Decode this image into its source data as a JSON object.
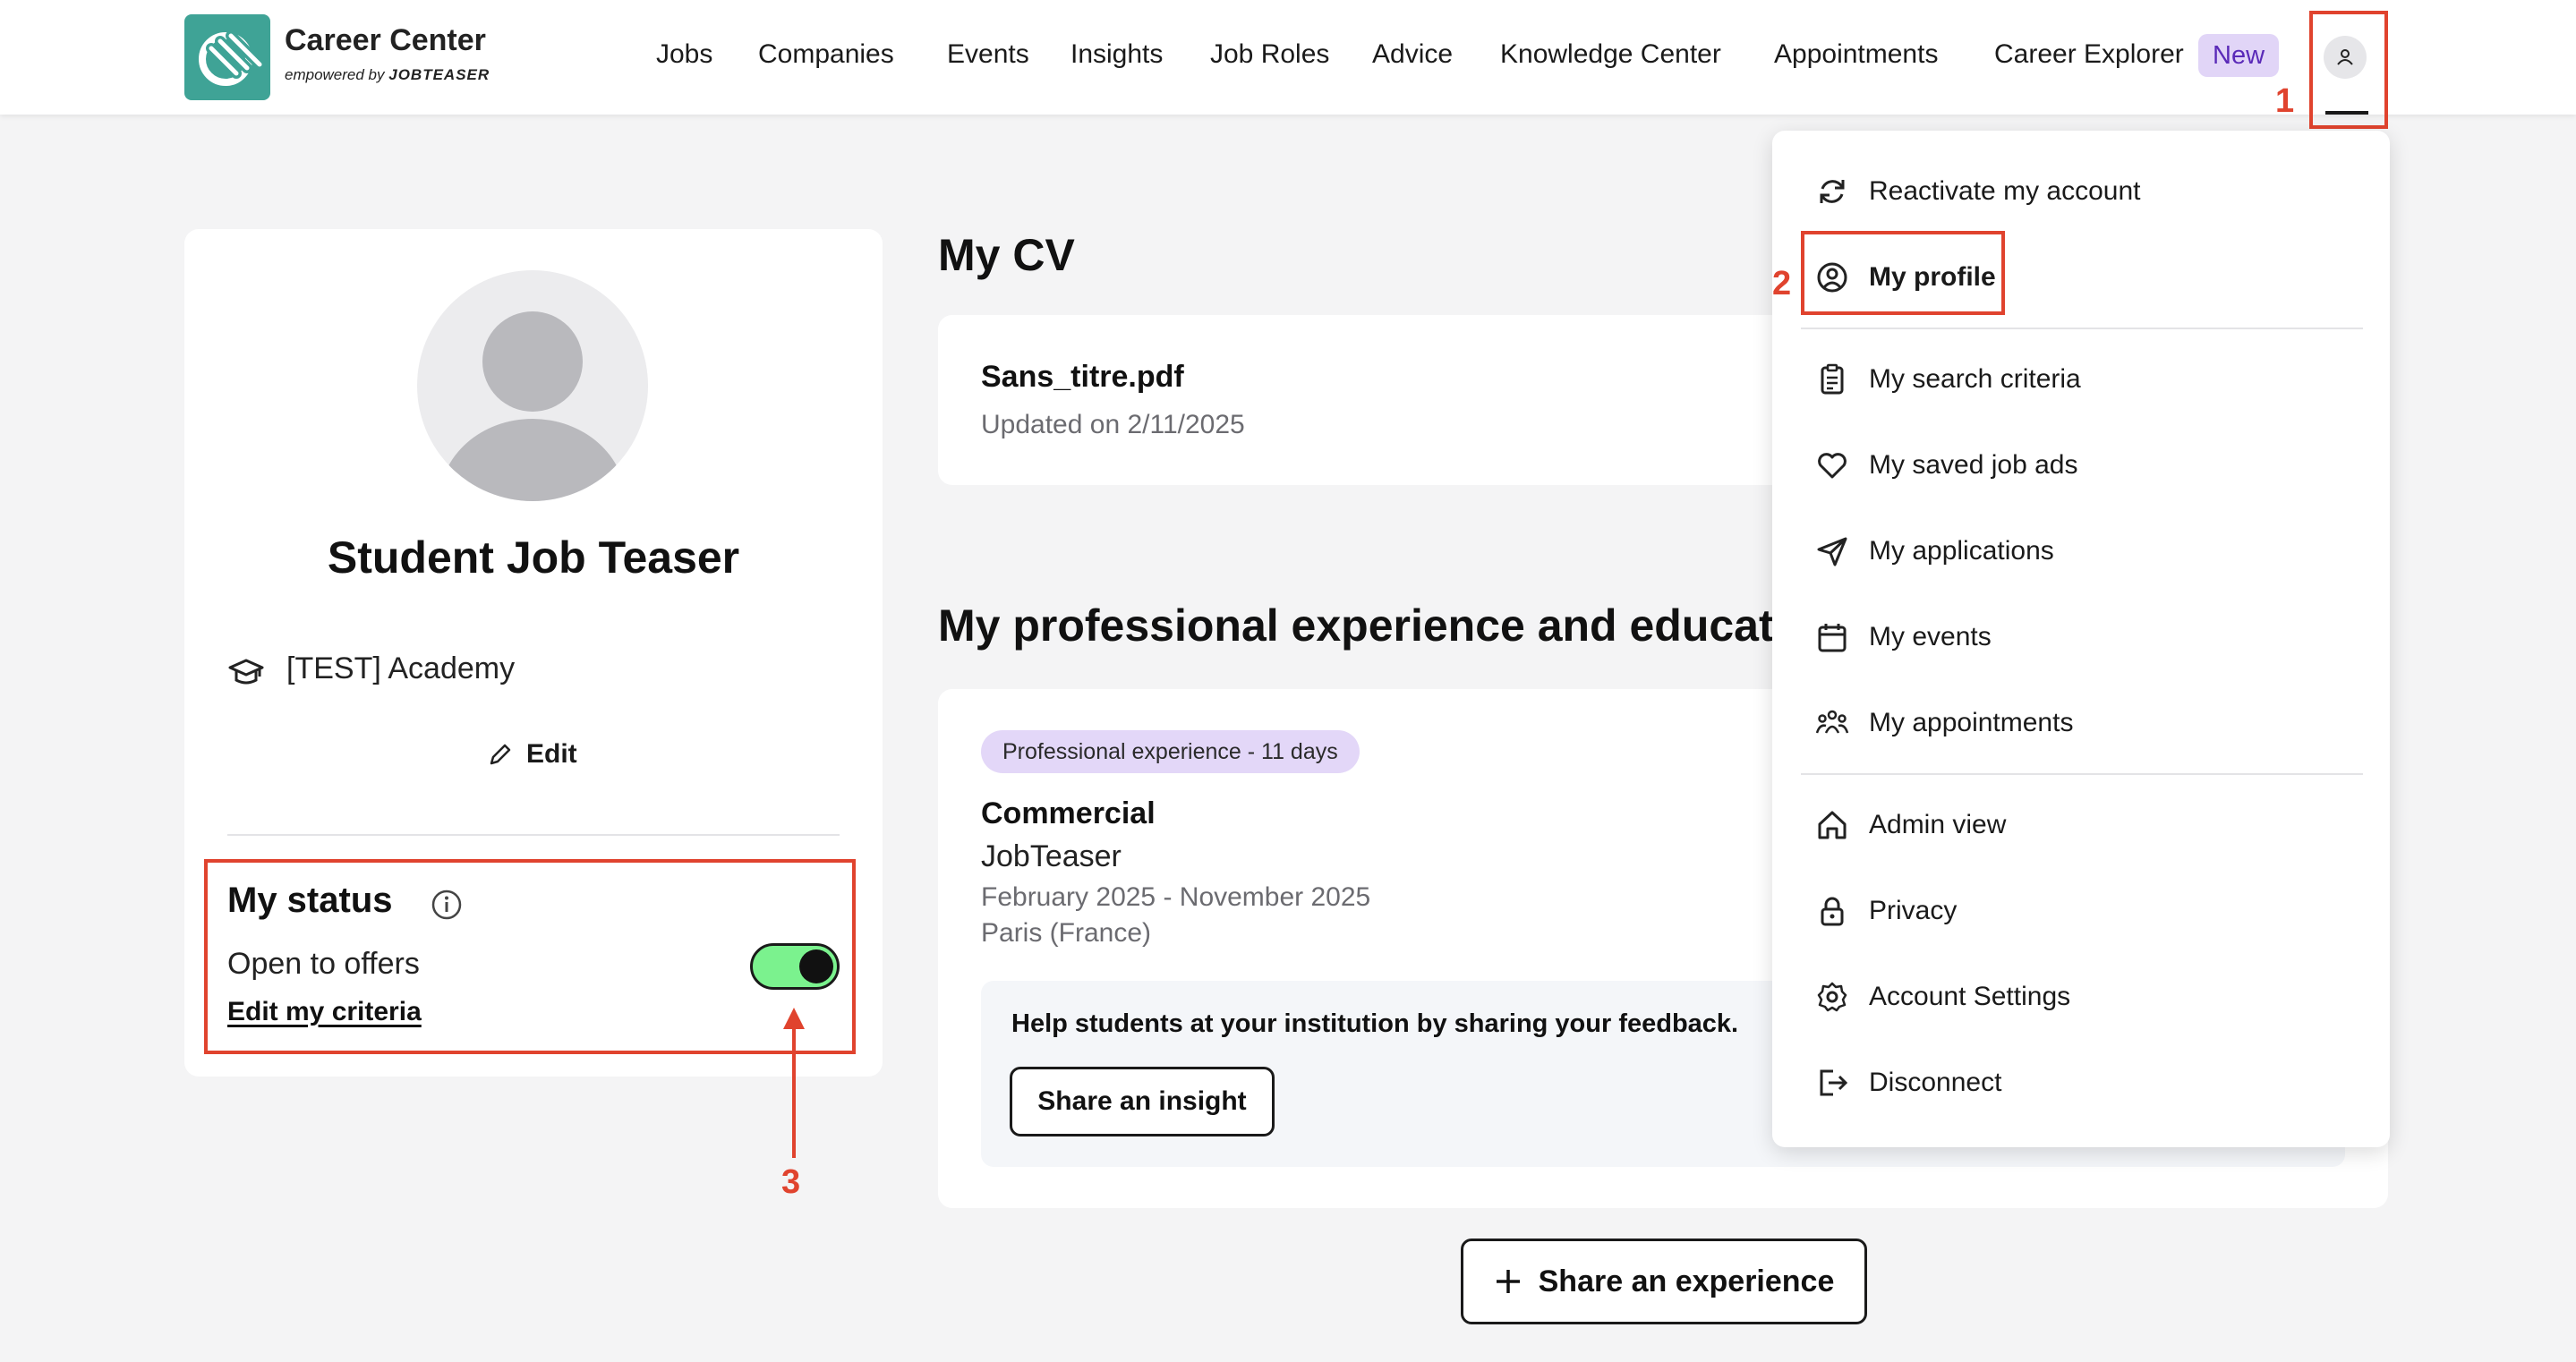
{
  "header": {
    "logo_title": "Career Center",
    "logo_sub_prefix": "empowered by",
    "logo_sub_brand": "JOBTEASER",
    "nav": [
      "Jobs",
      "Companies",
      "Events",
      "Insights",
      "Job Roles",
      "Advice",
      "Knowledge Center",
      "Appointments",
      "Career Explorer"
    ],
    "nav_badge": "New"
  },
  "profile": {
    "name": "Student Job Teaser",
    "school": "[TEST] Academy",
    "edit_label": "Edit",
    "status_title": "My status",
    "status_text": "Open to offers",
    "status_toggle_on": true,
    "criteria_link": "Edit my criteria"
  },
  "cv": {
    "title": "My CV",
    "file_name": "Sans_titre.pdf",
    "updated": "Updated on 2/11/2025"
  },
  "experience": {
    "title": "My professional experience and education",
    "badge": "Professional experience - 11 days",
    "role": "Commercial",
    "company": "JobTeaser",
    "dates": "February 2025 - November 2025",
    "location": "Paris (France)",
    "feedback_text": "Help students at your institution by sharing your feedback.",
    "insight_button": "Share an insight",
    "share_button": "Share an experience"
  },
  "menu": {
    "items": [
      {
        "label": "Reactivate my account",
        "icon": "refresh-icon"
      },
      {
        "label": "My profile",
        "icon": "user-circle-icon"
      },
      {
        "label": "My search criteria",
        "icon": "clipboard-icon"
      },
      {
        "label": "My saved job ads",
        "icon": "heart-icon"
      },
      {
        "label": "My applications",
        "icon": "send-icon"
      },
      {
        "label": "My events",
        "icon": "calendar-icon"
      },
      {
        "label": "My appointments",
        "icon": "people-icon"
      },
      {
        "label": "Admin view",
        "icon": "home-icon"
      },
      {
        "label": "Privacy",
        "icon": "lock-icon"
      },
      {
        "label": "Account Settings",
        "icon": "gear-icon"
      },
      {
        "label": "Disconnect",
        "icon": "logout-icon"
      }
    ]
  },
  "annotations": {
    "step1": "1",
    "step2": "2",
    "step3": "3",
    "color": "#e0432e"
  },
  "colors": {
    "teal": "#3fa396",
    "toggle_on": "#7bf28e",
    "badge_purple": "#e1d5f7"
  }
}
